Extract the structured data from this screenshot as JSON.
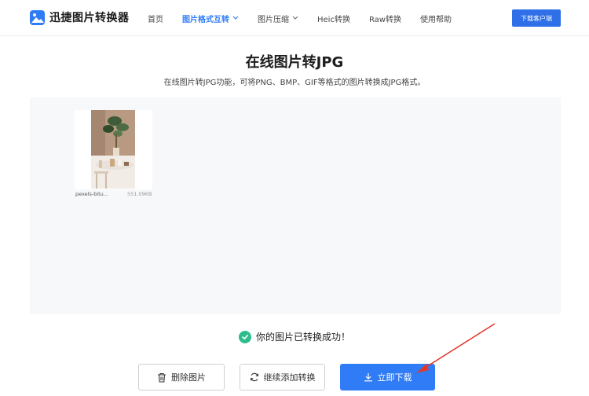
{
  "header": {
    "logo_text": "迅捷图片转换器",
    "nav": [
      {
        "label": "首页",
        "active": false,
        "dropdown": false
      },
      {
        "label": "图片格式互转",
        "active": true,
        "dropdown": true
      },
      {
        "label": "图片压缩",
        "active": false,
        "dropdown": true
      },
      {
        "label": "Heic转换",
        "active": false,
        "dropdown": false
      },
      {
        "label": "Raw转换",
        "active": false,
        "dropdown": false
      },
      {
        "label": "使用帮助",
        "active": false,
        "dropdown": false
      }
    ],
    "download_client_label": "下载客户端"
  },
  "main": {
    "title": "在线图片转JPG",
    "subtitle": "在线图片转JPG功能，可将PNG、BMP、GIF等格式的图片转换成JPG格式。",
    "files": [
      {
        "name": "pexels-bitu...",
        "size": "551.09KB"
      }
    ],
    "success_text": "你的图片已转换成功！"
  },
  "actions": {
    "delete_label": "删除图片",
    "continue_label": "继续添加转换",
    "download_label": "立即下载"
  },
  "colors": {
    "accent": "#2f7cf6",
    "success": "#2dbd8c",
    "annotation_arrow": "#e0382b"
  }
}
